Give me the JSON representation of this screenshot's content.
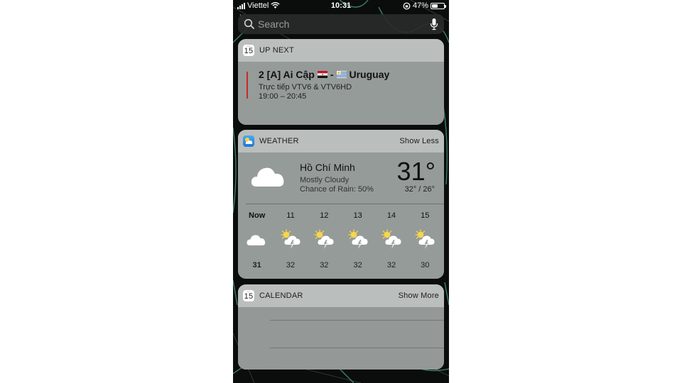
{
  "status_bar": {
    "carrier": "Viettel",
    "time": "10:31",
    "battery_percent_label": "47%",
    "battery_level": 0.47
  },
  "search": {
    "placeholder": "Search"
  },
  "up_next": {
    "header": "UP NEXT",
    "icon_day_number": "15",
    "event": {
      "title_prefix": "2 [A] Ai Cập",
      "separator": "-",
      "title_suffix": "Uruguay",
      "subtitle": "Trực tiếp VTV6 & VTV6HD",
      "time": "19:00 – 20:45",
      "accent_color": "#c92a2a"
    }
  },
  "weather": {
    "header": "WEATHER",
    "action": "Show Less",
    "city": "Hồ Chí Minh",
    "condition": "Mostly Cloudy",
    "chance_of_rain": "Chance of Rain: 50%",
    "temperature": "31°",
    "high_low": "32° / 26°",
    "hourly": [
      {
        "label": "Now",
        "icon": "cloud-icon",
        "temp": "31"
      },
      {
        "label": "11",
        "icon": "sun-thunderstorm-icon",
        "temp": "32"
      },
      {
        "label": "12",
        "icon": "sun-thunderstorm-icon",
        "temp": "32"
      },
      {
        "label": "13",
        "icon": "sun-thunderstorm-icon",
        "temp": "32"
      },
      {
        "label": "14",
        "icon": "sun-thunderstorm-icon",
        "temp": "32"
      },
      {
        "label": "15",
        "icon": "sun-thunderstorm-icon",
        "temp": "30"
      }
    ]
  },
  "calendar": {
    "header": "CALENDAR",
    "action": "Show More",
    "icon_day_number": "15"
  }
}
